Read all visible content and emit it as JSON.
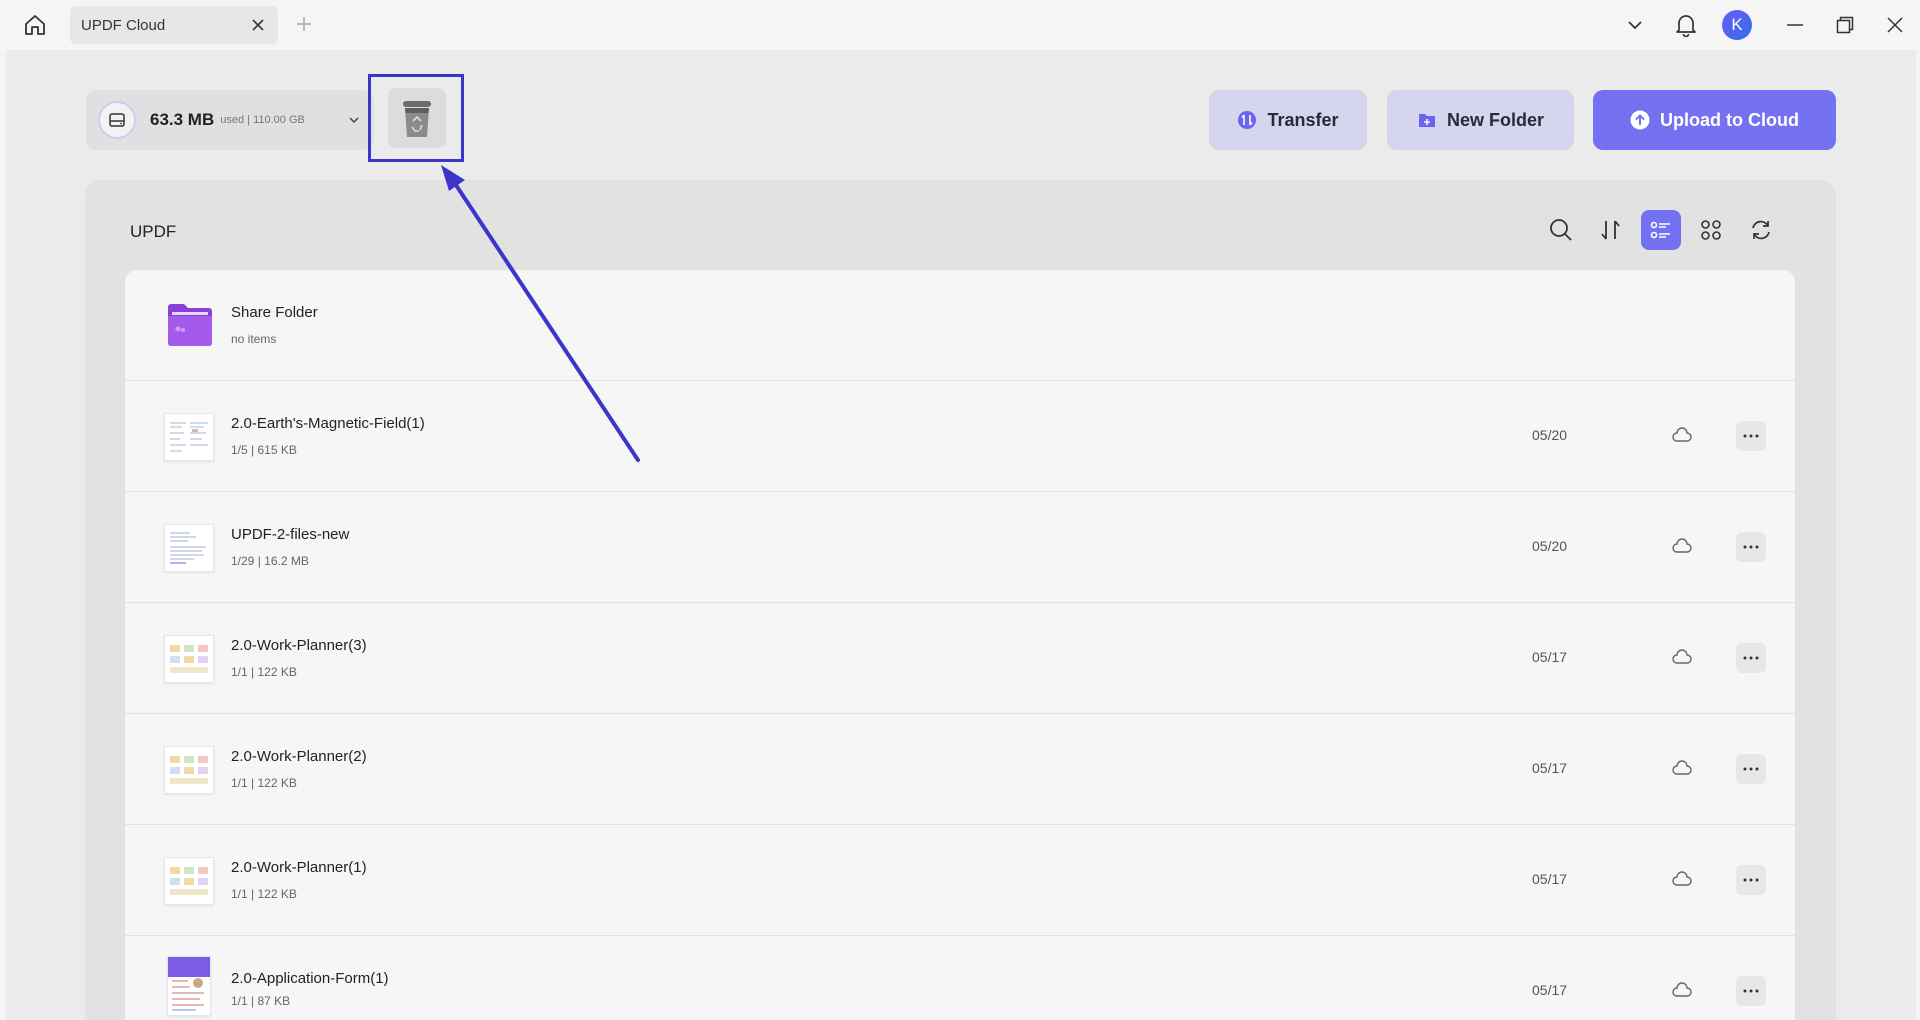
{
  "titlebar": {
    "tab_title": "UPDF Cloud",
    "avatar_letter": "K"
  },
  "storage": {
    "used": "63.3 MB",
    "label": "used | 110.00 GB"
  },
  "toolbar": {
    "transfer_label": "Transfer",
    "new_folder_label": "New Folder",
    "upload_label": "Upload to Cloud"
  },
  "panel": {
    "title": "UPDF"
  },
  "files": [
    {
      "name": "Share Folder",
      "meta": "no items",
      "date": "",
      "type": "folder"
    },
    {
      "name": "2.0-Earth's-Magnetic-Field(1)",
      "meta": "1/5 | 615 KB",
      "date": "05/20",
      "type": "doc"
    },
    {
      "name": "UPDF-2-files-new",
      "meta": "1/29 | 16.2 MB",
      "date": "05/20",
      "type": "doc"
    },
    {
      "name": "2.0-Work-Planner(3)",
      "meta": "1/1 | 122 KB",
      "date": "05/17",
      "type": "planner"
    },
    {
      "name": "2.0-Work-Planner(2)",
      "meta": "1/1 | 122 KB",
      "date": "05/17",
      "type": "planner"
    },
    {
      "name": "2.0-Work-Planner(1)",
      "meta": "1/1 | 122 KB",
      "date": "05/17",
      "type": "planner"
    },
    {
      "name": "2.0-Application-Form(1)",
      "meta": "1/1 | 87 KB",
      "date": "05/17",
      "type": "form"
    }
  ],
  "colors": {
    "accent": "#7471f2",
    "highlight": "#3b35c9",
    "folder": "#9b4fe0"
  }
}
